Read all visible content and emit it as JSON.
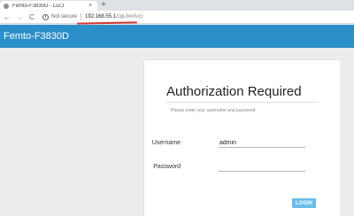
{
  "browser": {
    "tab_title": "Femto-F3830D - LuCI",
    "new_tab_symbol": "+",
    "close_symbol": "×",
    "back_symbol": "←",
    "forward_symbol": "→",
    "reload_symbol": "C",
    "info_symbol": "i",
    "security_label": "Not secure",
    "url_host": "192.168.55.1",
    "url_path": "/cgi-bin/luci",
    "highlight_color": "#d0362a"
  },
  "header": {
    "brand": "Femto-F3830D",
    "background_color": "#2b8fc9"
  },
  "login": {
    "title": "Authorization Required",
    "hint": "Please enter your username and password.",
    "username_label": "Username",
    "username_value": "admin",
    "password_label": "Password",
    "password_value": "",
    "submit_label": "LOGIN",
    "button_color": "#69bde8"
  }
}
